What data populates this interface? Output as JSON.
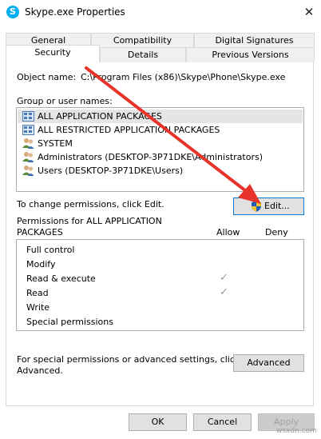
{
  "window": {
    "title": "Skype.exe Properties",
    "close_glyph": "✕",
    "app_icon_glyph": "S"
  },
  "tabs_row1": [
    {
      "label": "General"
    },
    {
      "label": "Compatibility"
    },
    {
      "label": "Digital Signatures"
    }
  ],
  "tabs_row2": [
    {
      "label": "Security"
    },
    {
      "label": "Details"
    },
    {
      "label": "Previous Versions"
    }
  ],
  "object": {
    "label": "Object name:",
    "value": "C:\\Program Files (x86)\\Skype\\Phone\\Skype.exe"
  },
  "groups": {
    "label": "Group or user names:",
    "items": [
      {
        "name": "ALL APPLICATION PACKAGES",
        "icon": "package-group-icon",
        "selected": true
      },
      {
        "name": "ALL RESTRICTED APPLICATION PACKAGES",
        "icon": "package-group-icon"
      },
      {
        "name": "SYSTEM",
        "icon": "users-icon"
      },
      {
        "name": "Administrators (DESKTOP-3P71DKE\\Administrators)",
        "icon": "users-icon"
      },
      {
        "name": "Users (DESKTOP-3P71DKE\\Users)",
        "icon": "users-icon"
      }
    ]
  },
  "change_text": "To change permissions, click Edit.",
  "edit_button": "Edit...",
  "permissions": {
    "label_line1": "Permissions for ALL APPLICATION",
    "label_line2": "PACKAGES",
    "allow_header": "Allow",
    "deny_header": "Deny",
    "check_glyph": "✓",
    "rows": [
      {
        "name": "Full control",
        "allow": false
      },
      {
        "name": "Modify",
        "allow": false
      },
      {
        "name": "Read & execute",
        "allow": true
      },
      {
        "name": "Read",
        "allow": true
      },
      {
        "name": "Write",
        "allow": false
      },
      {
        "name": "Special permissions",
        "allow": false
      }
    ]
  },
  "special": {
    "line1": "For special permissions or advanced settings, click",
    "line2": "Advanced.",
    "button": "Advanced"
  },
  "footer": {
    "ok": "OK",
    "cancel": "Cancel",
    "apply": "Apply"
  },
  "watermark": "wsxdn.com",
  "colors": {
    "annotation_arrow": "#e8332a",
    "skype_blue": "#00aff0",
    "focus_border": "#0078d7"
  }
}
